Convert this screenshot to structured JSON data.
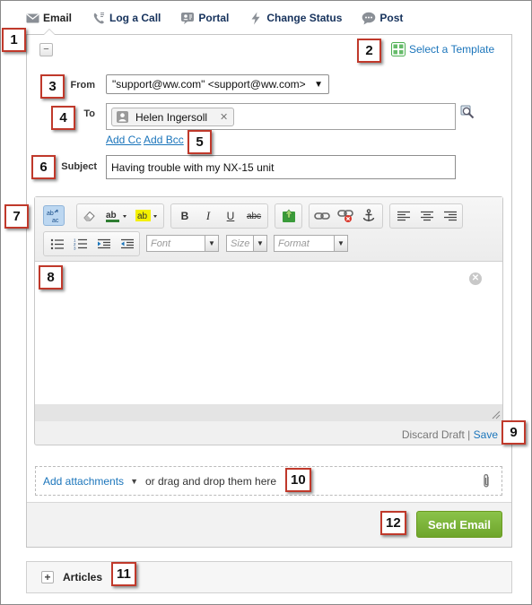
{
  "tabs": [
    {
      "label": "Email",
      "icon": "email-icon",
      "active": true
    },
    {
      "label": "Log a Call",
      "icon": "phone-icon",
      "active": false
    },
    {
      "label": "Portal",
      "icon": "portal-icon",
      "active": false
    },
    {
      "label": "Change Status",
      "icon": "lightning-icon",
      "active": false
    },
    {
      "label": "Post",
      "icon": "chat-bubble-icon",
      "active": false
    }
  ],
  "composer": {
    "collapse_symbol": "−",
    "template_label": "Select a Template",
    "from_label": "From",
    "from_value": "\"support@ww.com\" <support@ww.com>",
    "to_label": "To",
    "to_recipient": "Helen Ingersoll",
    "add_cc": "Add Cc",
    "add_bcc": "Add Bcc",
    "subject_label": "Subject",
    "subject_value": "Having trouble with my NX-15 unit"
  },
  "editor": {
    "font_placeholder": "Font",
    "size_placeholder": "Size",
    "format_placeholder": "Format",
    "discard_label": "Discard Draft",
    "separator": "|",
    "save_label": "Save"
  },
  "attachments": {
    "add_label": "Add attachments",
    "drag_text": "or drag and drop them here"
  },
  "send_button": "Send Email",
  "articles_label": "Articles",
  "callouts": [
    "1",
    "2",
    "3",
    "4",
    "5",
    "6",
    "7",
    "8",
    "9",
    "10",
    "11",
    "12"
  ],
  "colors": {
    "link_blue": "#1b75bb",
    "send_green": "#7cb342",
    "callout_red": "#c0392b"
  }
}
